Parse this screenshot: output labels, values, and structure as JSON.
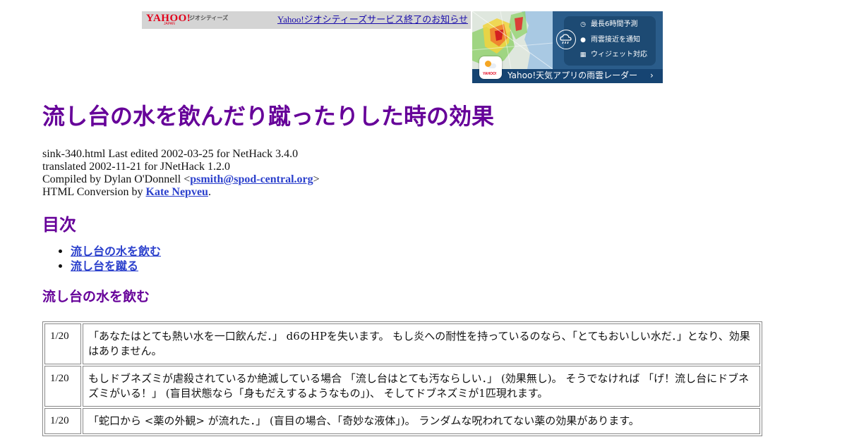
{
  "banner": {
    "logo_text": "YAHOO!",
    "logo_sub": "JAPAN",
    "brand_text": "ジオシティーズ",
    "notice_link": "Yahoo!ジオシティーズサービス終了のお知らせ"
  },
  "ad": {
    "features": [
      {
        "icon": "clock-icon",
        "glyph": "◷",
        "label": "最長6時間予測"
      },
      {
        "icon": "pin-icon",
        "glyph": "●",
        "label": "雨雲接近を通知"
      },
      {
        "icon": "widget-icon",
        "glyph": "▦",
        "label": "ウィジェット対応"
      }
    ],
    "caption": "Yahoo!天気アプリの雨雲レーダー",
    "chevron": "›",
    "app_logo": "YAHOO!"
  },
  "page": {
    "title": "流し台の水を飲んだり蹴ったりした時の効果",
    "meta": {
      "line1": "sink-340.html Last edited 2002-03-25 for NetHack 3.4.0",
      "line2": "translated 2002-11-21 for JNetHack 1.2.0",
      "compiled_prefix": "Compiled by Dylan O'Donnell <",
      "compiled_email": "psmith@spod-central.org",
      "compiled_suffix": ">",
      "conversion_prefix": "HTML Conversion by ",
      "conversion_name": "Kate Nepveu",
      "conversion_suffix": "."
    },
    "toc_heading": "目次",
    "toc": [
      "流し台の水を飲む",
      "流し台を蹴る"
    ],
    "section_heading": "流し台の水を飲む",
    "table": [
      {
        "prob": "1/20",
        "text": "「あなたはとても熱い水を一口飲んだ．」 d6のHPを失います。 もし炎への耐性を持っているのなら、「とてもおいしい水だ．」となり、効果はありません。"
      },
      {
        "prob": "1/20",
        "text": "もしドブネズミが虐殺されているか絶滅している場合 「流し台はとても汚ならしい．」 (効果無し)。 そうでなければ 「げ！流し台にドブネズミがいる！」 (盲目状態なら「身もだえするようなもの」)、 そしてドブネズミが1匹現れます。"
      },
      {
        "prob": "1/20",
        "text": "「蛇口から <薬の外観> が流れた．」 (盲目の場合、「奇妙な液体」)。 ランダムな呪われてない薬の効果があります。"
      }
    ]
  }
}
